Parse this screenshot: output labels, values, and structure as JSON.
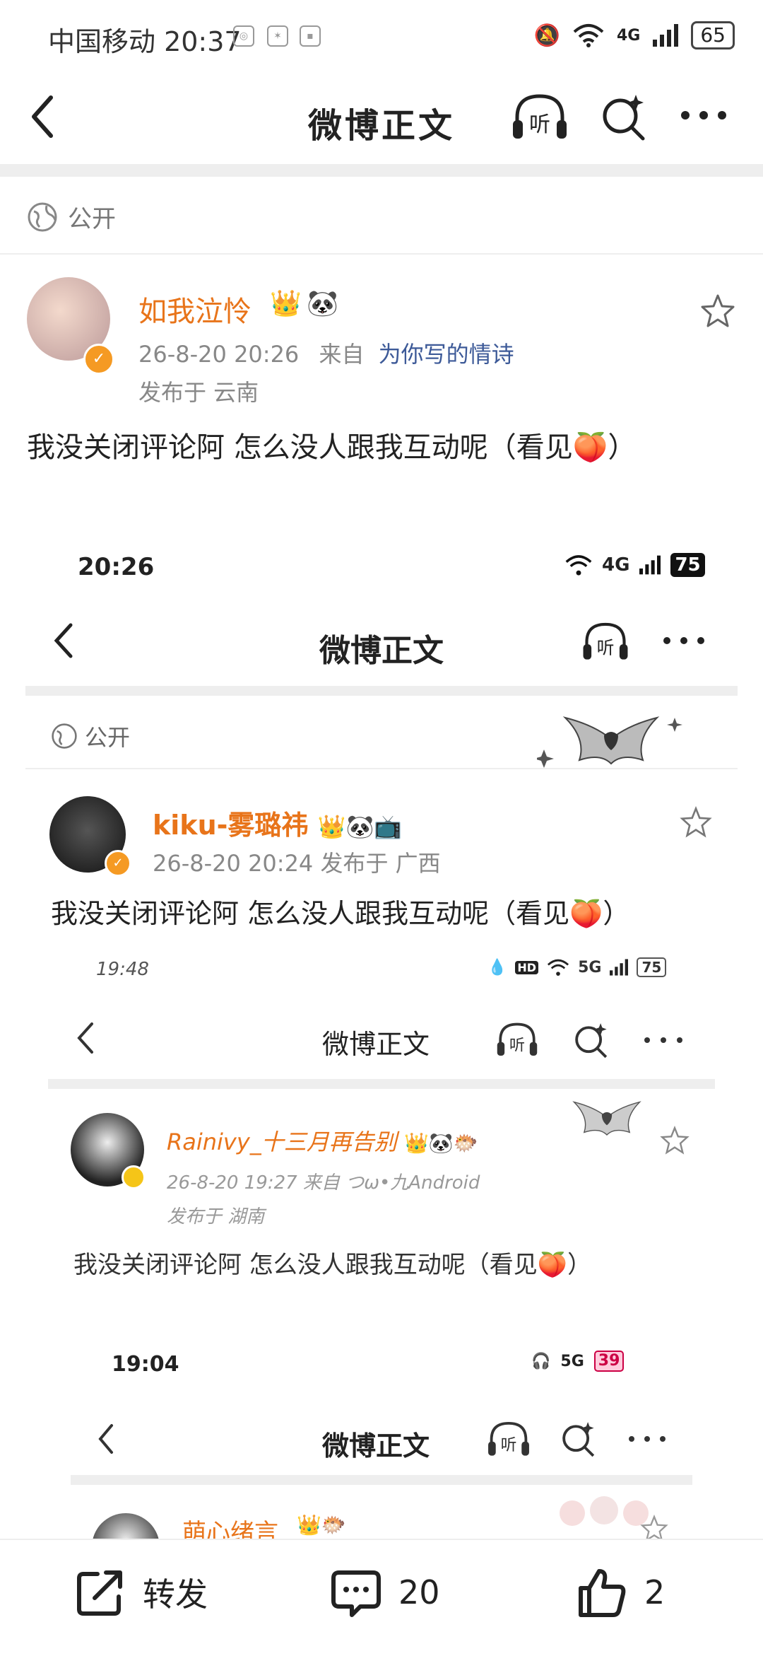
{
  "status_bar": {
    "carrier_time": "中国移动 20:37",
    "battery": "65",
    "network": "4G"
  },
  "nav": {
    "title": "微博正文",
    "icons": [
      "back-icon",
      "listen-icon",
      "search-icon",
      "more-icon"
    ]
  },
  "post": {
    "visibility": "公开",
    "username": "如我泣怜",
    "time": "26-8-20 20:26",
    "from_prefix": "来自",
    "source": "为你写的情诗",
    "location": "发布于 云南",
    "text": "我没关闭评论阿 怎么没人跟我互动呢（看见🍑）"
  },
  "embedded_1": {
    "time": "20:26",
    "battery": "75",
    "network": "4G",
    "title": "微博正文",
    "visibility": "公开",
    "username": "kiku-雾璐祎",
    "meta": "26-8-20 20:24  发布于 广西",
    "text": "我没关闭评论阿 怎么没人跟我互动呢（看见🍑）"
  },
  "embedded_2": {
    "time": "19:48",
    "battery": "75",
    "network": "5G",
    "title": "微博正文",
    "username": "Rainivy_十三月再告别",
    "meta": "26-8-20 19:27  来自 つω•九Android",
    "location": "发布于 湖南",
    "text": "我没关闭评论阿 怎么没人跟我互动呢（看见🍑）"
  },
  "embedded_3": {
    "time": "19:04",
    "battery": "39",
    "network": "5G",
    "title": "微博正文",
    "username": "萌心绪言"
  },
  "bottom_bar": {
    "repost_label": "转发",
    "comment_count": "20",
    "like_count": "2"
  }
}
